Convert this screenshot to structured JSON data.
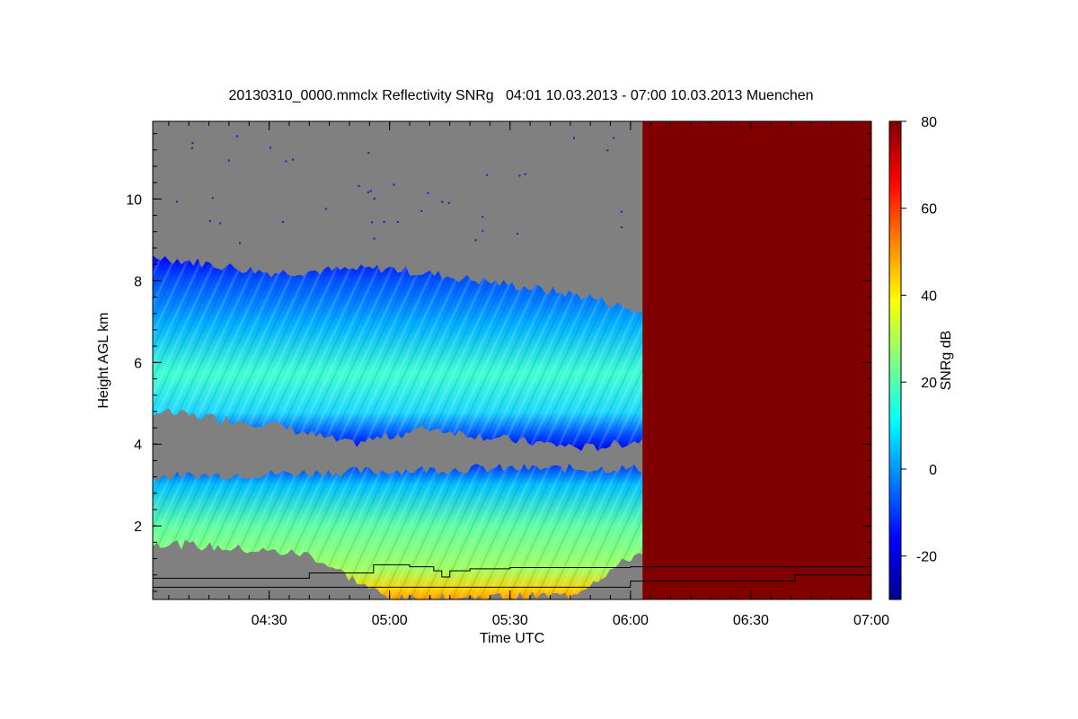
{
  "chart_data": {
    "type": "heatmap",
    "title": "20130310_0000.mmclx Reflectivity SNRg   04:01 10.03.2013 - 07:00 10.03.2013 Muenchen",
    "xlabel": "Time UTC",
    "ylabel": "Height AGL km",
    "colorbar_label": "SNRg dB",
    "x_range_minutes_utc": [
      241,
      420
    ],
    "x_ticks": [
      {
        "label": "04:30",
        "minutes": 270
      },
      {
        "label": "05:00",
        "minutes": 300
      },
      {
        "label": "05:30",
        "minutes": 330
      },
      {
        "label": "06:00",
        "minutes": 360
      },
      {
        "label": "06:30",
        "minutes": 390
      },
      {
        "label": "07:00",
        "minutes": 420
      }
    ],
    "y_range_km": [
      0.2,
      11.9
    ],
    "y_ticks": [
      2,
      4,
      6,
      8,
      10
    ],
    "colorbar_range_db": [
      -30,
      80
    ],
    "colorbar_ticks": [
      -20,
      0,
      20,
      40,
      60,
      80
    ],
    "no_signal_color": "#808080",
    "no_data_color": "#800000",
    "colormap": [
      "#00008f",
      "#0000ff",
      "#0080ff",
      "#00ffff",
      "#80ff80",
      "#ffff00",
      "#ff8000",
      "#ff0000",
      "#800000"
    ],
    "no_data_start_minutes": 363,
    "cloud_layers": [
      {
        "name": "upper",
        "start_minutes": 241,
        "end_minutes": 363,
        "top_km": [
          [
            241,
            8.6
          ],
          [
            270,
            8.2
          ],
          [
            300,
            8.3
          ],
          [
            330,
            7.9
          ],
          [
            350,
            7.6
          ],
          [
            363,
            7.2
          ]
        ],
        "base_km": [
          [
            241,
            4.8
          ],
          [
            270,
            4.5
          ],
          [
            290,
            4.0
          ],
          [
            310,
            4.4
          ],
          [
            330,
            4.1
          ],
          [
            350,
            3.9
          ],
          [
            363,
            4.1
          ]
        ],
        "peak_snr_db": 25
      },
      {
        "name": "lower",
        "start_minutes": 241,
        "end_minutes": 363,
        "top_km": [
          [
            241,
            3.2
          ],
          [
            280,
            3.3
          ],
          [
            320,
            3.4
          ],
          [
            363,
            3.4
          ]
        ],
        "base_km": [
          [
            241,
            1.6
          ],
          [
            280,
            1.3
          ],
          [
            300,
            0.2
          ],
          [
            345,
            0.3
          ],
          [
            363,
            1.4
          ]
        ],
        "peak_snr_db": 50
      }
    ],
    "overlay_lines_km": [
      {
        "name": "line-a",
        "points": [
          [
            241,
            0.72
          ],
          [
            270,
            0.72
          ],
          [
            280,
            0.85
          ],
          [
            295,
            0.85
          ],
          [
            296,
            1.05
          ],
          [
            305,
            1.0
          ],
          [
            311,
            0.9
          ],
          [
            313,
            0.75
          ],
          [
            315,
            0.9
          ],
          [
            320,
            0.95
          ],
          [
            330,
            0.98
          ],
          [
            360,
            1.0
          ],
          [
            420,
            1.0
          ]
        ]
      },
      {
        "name": "line-b",
        "points": [
          [
            241,
            0.5
          ],
          [
            330,
            0.5
          ],
          [
            360,
            0.65
          ],
          [
            400,
            0.65
          ],
          [
            401,
            0.8
          ],
          [
            420,
            0.8
          ]
        ]
      }
    ]
  }
}
